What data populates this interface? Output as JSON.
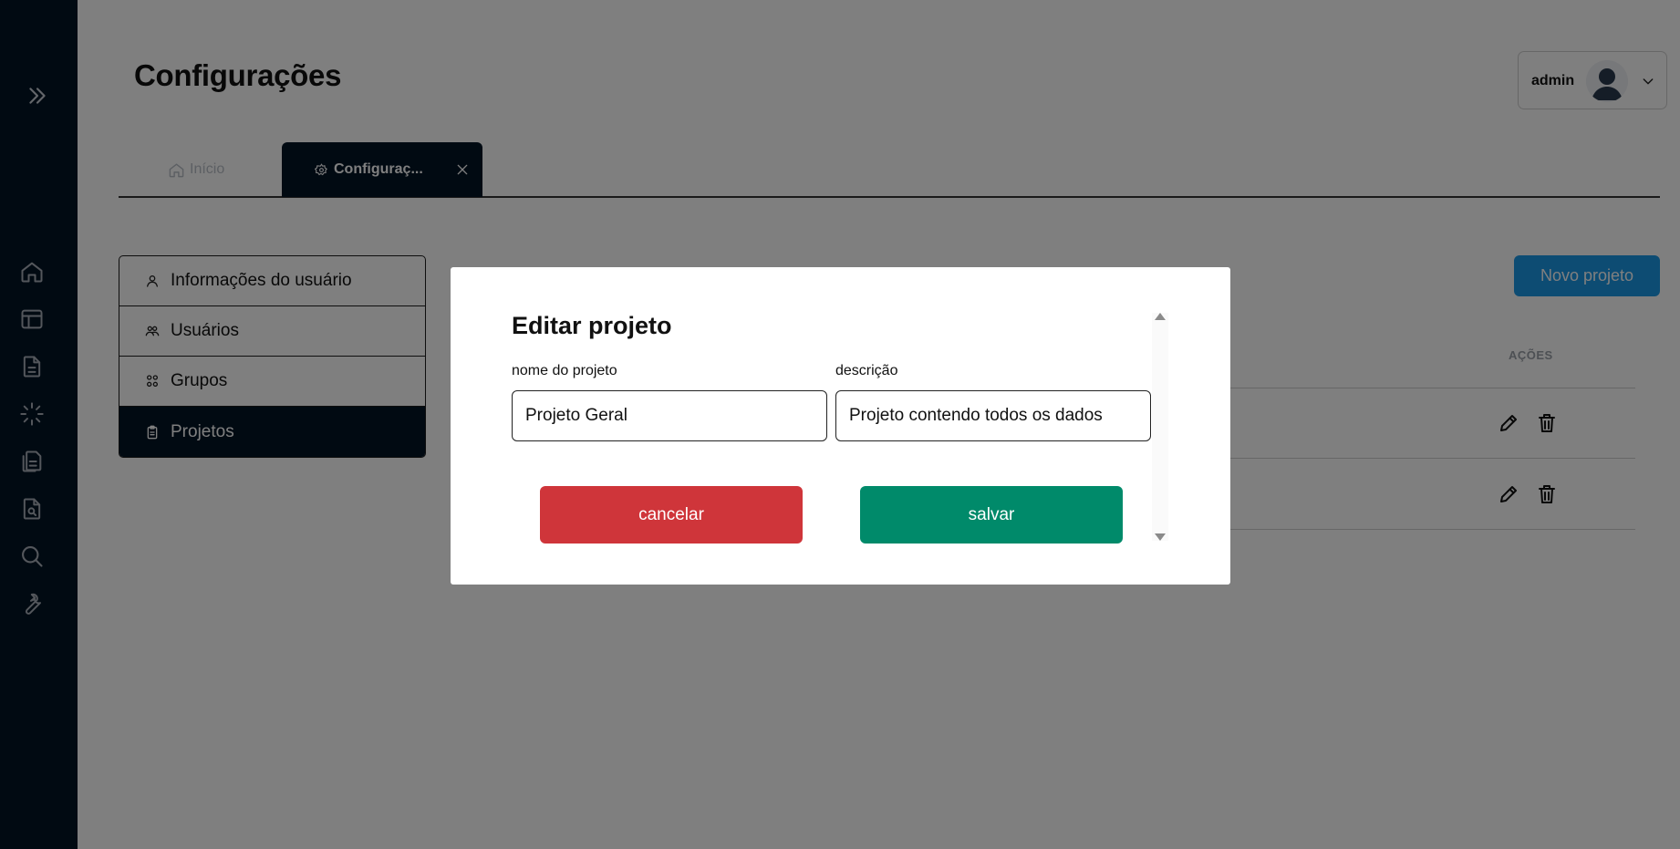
{
  "page": {
    "title": "Configurações"
  },
  "user": {
    "name": "admin",
    "avatar_icon": "user-avatar-icon",
    "chevron_icon": "chevron-down-icon"
  },
  "sidebar": {
    "toggle_icon": "double-chevron-right-icon",
    "items": [
      {
        "icon": "home-icon"
      },
      {
        "icon": "layout-icon"
      },
      {
        "icon": "document-icon"
      },
      {
        "icon": "loader-icon"
      },
      {
        "icon": "documents-icon"
      },
      {
        "icon": "file-search-icon"
      },
      {
        "icon": "search-icon"
      },
      {
        "icon": "wrench-icon"
      }
    ]
  },
  "tabs": [
    {
      "label": "Início",
      "icon": "home-icon"
    },
    {
      "label": "Configuraç...",
      "icon": "gear-icon",
      "active": true
    }
  ],
  "settings_menu": {
    "items": [
      {
        "label": "Informações do usuário",
        "icon": "user-icon"
      },
      {
        "label": "Usuários",
        "icon": "users-icon"
      },
      {
        "label": "Grupos",
        "icon": "groups-icon"
      },
      {
        "label": "Projetos",
        "icon": "clipboard-icon",
        "active": true
      }
    ]
  },
  "projects": {
    "new_button": "Novo projeto",
    "actions_header": "AÇÕES",
    "rows": [
      {
        "edit_icon": "pencil-icon",
        "delete_icon": "trash-icon"
      },
      {
        "edit_icon": "pencil-icon",
        "delete_icon": "trash-icon"
      }
    ]
  },
  "modal": {
    "title": "Editar projeto",
    "fields": {
      "name": {
        "label": "nome do projeto",
        "value": "Projeto Geral"
      },
      "description": {
        "label": "descrição",
        "value": "Projeto contendo todos os dados"
      }
    },
    "cancel_label": "cancelar",
    "save_label": "salvar"
  },
  "colors": {
    "sidebar_bg": "#031525",
    "primary_blue": "#1a98e6",
    "cancel_red": "#cf353a",
    "save_green": "#008a6a",
    "overlay": "rgba(0,0,0,0.5)"
  }
}
